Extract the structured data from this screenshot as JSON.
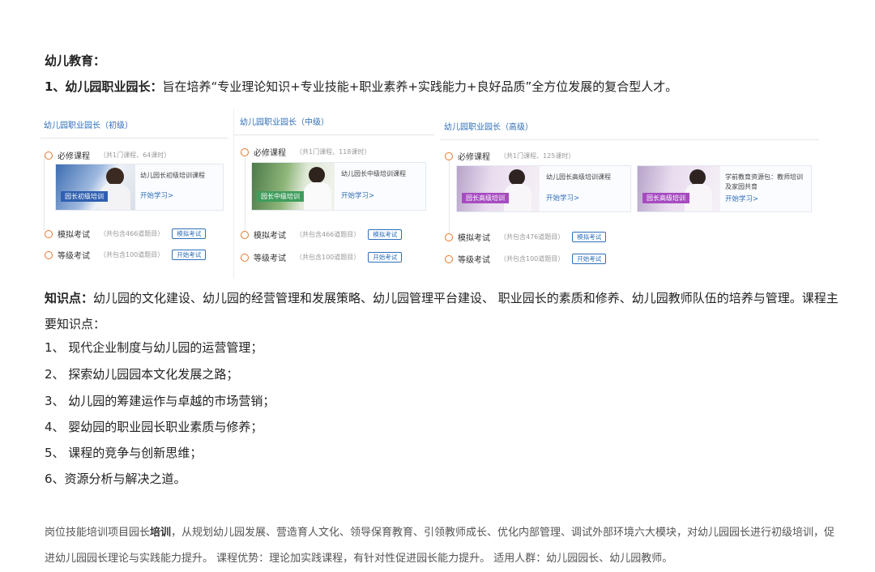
{
  "section_title": "幼儿教育：",
  "lead": {
    "bold": "1、幼儿园职业园长：",
    "text": "旨在培养“专业理论知识+专业技能+职业素养+实践能力+良好品质”全方位发展的复合型人才。"
  },
  "panels": [
    {
      "title": "幼儿园职业园长（初级）",
      "required": {
        "label": "必修课程",
        "note": "（共1门课程、64课时）"
      },
      "courses": [
        {
          "thumb_label": "园长初级培训",
          "title": "幼儿园长初级培训课程",
          "start": "开始学习>"
        }
      ],
      "mock": {
        "label": "模拟考试",
        "note": "（共包含466道题目）",
        "button": "模拟考试"
      },
      "grade": {
        "label": "等级考试",
        "note": "（共包含100道题目）",
        "button": "开始考试"
      }
    },
    {
      "title": "幼儿园职业园长（中级）",
      "required": {
        "label": "必修课程",
        "note": "（共1门课程、118课时）"
      },
      "courses": [
        {
          "thumb_label": "园长中级培训",
          "title": "幼儿园长中级培训课程",
          "start": "开始学习>"
        }
      ],
      "mock": {
        "label": "模拟考试",
        "note": "（共包含466道题目）",
        "button": "模拟考试"
      },
      "grade": {
        "label": "等级考试",
        "note": "（共包含100道题目）",
        "button": "开始考试"
      }
    },
    {
      "title": "幼儿园职业园长（高级）",
      "required": {
        "label": "必修课程",
        "note": "（共1门课程、125课时）"
      },
      "courses": [
        {
          "thumb_label": "园长高级培训",
          "title": "幼儿园长高级培训课程",
          "start": "开始学习>"
        },
        {
          "thumb_label": "园长高级培训",
          "title": "学前教育资源包：教师培训及家园共育",
          "start": "开始学习>"
        }
      ],
      "mock": {
        "label": "模拟考试",
        "note": "（共包含476道题目）",
        "button": "模拟考试"
      },
      "grade": {
        "label": "等级考试",
        "note": "（共包含100道题目）",
        "button": "开始考试"
      }
    }
  ],
  "knowledge": {
    "bold": "知识点：",
    "text": "幼儿园的文化建设、幼儿园的经营管理和发展策略、幼儿园管理平台建设、 职业园长的素质和修养、幼儿园教师队伍的培养与管理。课程主要知识点："
  },
  "points": [
    "1、 现代企业制度与幼儿园的运营管理；",
    "2、 探索幼儿园园本文化发展之路；",
    "3、 幼儿园的筹建运作与卓越的市场营销；",
    "4、 婴幼园的职业园长职业素质与修养；",
    "5、 课程的竞争与创新思维；",
    "6、资源分析与解决之道。"
  ],
  "footer": {
    "pre": "岗位技能培训项目园长",
    "bold": "培训",
    "text": "，从规划幼儿园发展、营造育人文化、领导保育教育、引领教师成长、优化内部管理、调试外部环境六大模块，对幼儿园园长进行初级培训，促进幼儿园园长理论与实践能力提升。 课程优势：理论加实践课程，有针对性促进园长能力提升。 适用人群：幼儿园园长、幼儿园教师。"
  },
  "colors": {
    "link": "#2f6fb8",
    "circle": "#e8762a"
  }
}
